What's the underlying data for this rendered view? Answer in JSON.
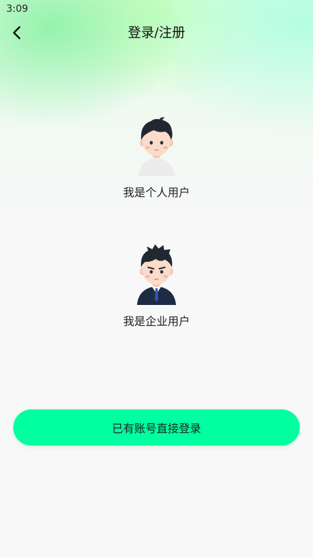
{
  "status_bar": {
    "time": "3:09"
  },
  "nav": {
    "title": "登录/注册",
    "back_icon": "chevron-left-icon"
  },
  "roles": [
    {
      "label": "我是个人用户",
      "icon": "personal-user-avatar"
    },
    {
      "label": "我是企业用户",
      "icon": "business-user-avatar"
    }
  ],
  "login_button": {
    "label": "已有账号直接登录"
  },
  "colors": {
    "accent": "#00ff9f",
    "background": "#f8f8f8",
    "gradient_green": "#78f096",
    "gradient_mint": "#aaffe1"
  }
}
